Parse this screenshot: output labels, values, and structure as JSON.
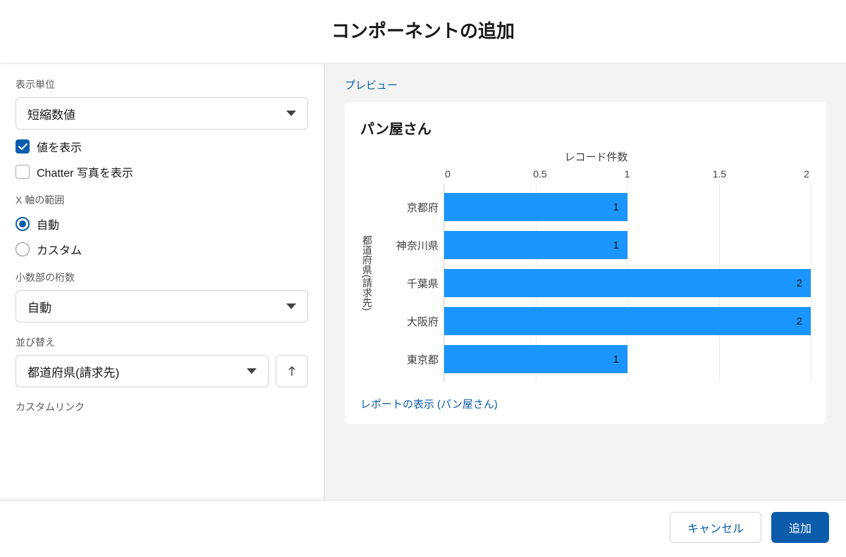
{
  "header": {
    "title": "コンポーネントの追加"
  },
  "left": {
    "displayUnit": {
      "label": "表示単位",
      "value": "短縮数値"
    },
    "checkboxes": {
      "showValues": {
        "label": "値を表示",
        "checked": true
      },
      "showChatter": {
        "label": "Chatter 写真を表示",
        "checked": false
      }
    },
    "xAxisRange": {
      "label": "X 軸の範囲",
      "options": {
        "auto": "自動",
        "custom": "カスタム"
      },
      "selected": "auto"
    },
    "decimalPlaces": {
      "label": "小数部の桁数",
      "value": "自動"
    },
    "sort": {
      "label": "並び替え",
      "value": "都道府県(請求先)"
    },
    "customLink": {
      "label": "カスタムリンク"
    }
  },
  "preview": {
    "label": "プレビュー",
    "chartTitle": "パン屋さん",
    "reportLink": "レポートの表示 (パン屋さん)"
  },
  "chart_data": {
    "type": "bar",
    "orientation": "horizontal",
    "title": "パン屋さん",
    "xlabel": "レコード件数",
    "ylabel": "都道府県(請求先)",
    "xlim": [
      0,
      2
    ],
    "xticks": [
      0,
      0.5,
      1,
      1.5,
      2
    ],
    "categories": [
      "京都府",
      "神奈川県",
      "千葉県",
      "大阪府",
      "東京都"
    ],
    "values": [
      1,
      1,
      2,
      2,
      1
    ]
  },
  "footer": {
    "cancel": "キャンセル",
    "add": "追加"
  }
}
